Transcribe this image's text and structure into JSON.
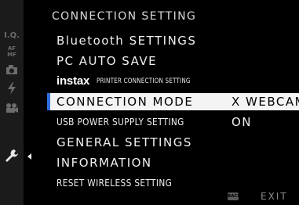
{
  "header": {
    "title": "CONNECTION SETTING"
  },
  "sidebar": {
    "tabs": [
      {
        "icon": "image-quality-icon",
        "text": "I.Q."
      },
      {
        "icon": "af-mf-icon",
        "text": "AF MF"
      },
      {
        "icon": "camera-icon",
        "text": ""
      },
      {
        "icon": "flash-icon",
        "text": ""
      },
      {
        "icon": "movie-icon",
        "text": ""
      },
      {
        "icon": "wrench-icon",
        "text": "",
        "active": true
      }
    ]
  },
  "menu": {
    "items": [
      {
        "label": "Bluetooth SETTINGS",
        "value": ""
      },
      {
        "label": "PC AUTO SAVE",
        "value": ""
      },
      {
        "label_logo": "instax",
        "label_rest": "PRINTER CONNECTION SETTING",
        "value": ""
      },
      {
        "label": "CONNECTION MODE",
        "value": "X WEBCAM",
        "selected": true
      },
      {
        "label": "USB POWER SUPPLY SETTING",
        "value": "ON"
      },
      {
        "label": "GENERAL SETTINGS",
        "value": ""
      },
      {
        "label": "INFORMATION",
        "value": ""
      },
      {
        "label": "RESET WIRELESS SETTING",
        "value": ""
      }
    ]
  },
  "footer": {
    "back_badge": "BACK",
    "exit_label": "EXIT"
  },
  "colors": {
    "cursor": "#2f6fe0",
    "highlight": "#f4f4f4",
    "background": "#000000"
  }
}
